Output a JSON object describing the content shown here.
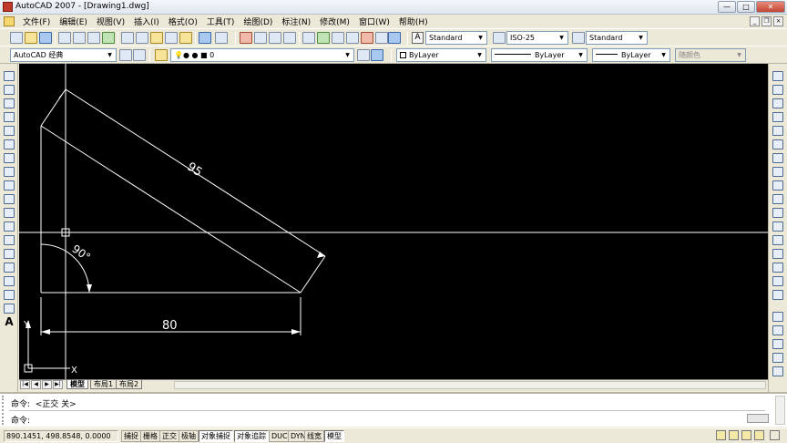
{
  "window": {
    "title": "AutoCAD 2007 - [Drawing1.dwg]"
  },
  "window_buttons": {
    "minimize": "—",
    "maximize": "□",
    "close": "✕"
  },
  "mdi_buttons": {
    "minimize": "_",
    "restore": "❐",
    "close": "×"
  },
  "menu": [
    "文件(F)",
    "编辑(E)",
    "视图(V)",
    "插入(I)",
    "格式(O)",
    "工具(T)",
    "绘图(D)",
    "标注(N)",
    "修改(M)",
    "窗口(W)",
    "帮助(H)"
  ],
  "styles_toolbar": {
    "text_style_icon": "A",
    "text_style": "Standard",
    "dim_style": "ISO-25",
    "table_style": "Standard"
  },
  "workspace": {
    "value": "AutoCAD 经典"
  },
  "layer": {
    "value": "0"
  },
  "properties": {
    "color": "ByLayer",
    "linetype": "ByLayer",
    "lineweight": "ByLayer",
    "plotstyle": "随颜色"
  },
  "drawing": {
    "dim_aligned": "95",
    "dim_linear": "80",
    "angle": "90°",
    "ucs_x": "X",
    "ucs_y": "Y",
    "line_color": "#ffffff",
    "background": "#000000"
  },
  "tabs": {
    "nav": [
      "|◀",
      "◀",
      "▶",
      "▶|"
    ],
    "items": [
      "模型",
      "布局1",
      "布局2"
    ],
    "active": "模型"
  },
  "command": {
    "history": "命令:  <正交 关>",
    "prompt": "命令:"
  },
  "status": {
    "coords": "890.1451,  498.8548, 0.0000",
    "buttons": [
      {
        "label": "捕捉",
        "on": false
      },
      {
        "label": "栅格",
        "on": false
      },
      {
        "label": "正交",
        "on": false
      },
      {
        "label": "极轴",
        "on": false
      },
      {
        "label": "对象捕捉",
        "on": true
      },
      {
        "label": "对象追踪",
        "on": true
      },
      {
        "label": "DUCS",
        "on": false
      },
      {
        "label": "DYN",
        "on": false
      },
      {
        "label": "线宽",
        "on": false
      },
      {
        "label": "模型",
        "on": true
      }
    ]
  },
  "icons": {
    "left_toolbar": [
      "line-icon",
      "construction-line-icon",
      "polyline-icon",
      "polygon-icon",
      "rectangle-icon",
      "arc-icon",
      "circle-icon",
      "revision-cloud-icon",
      "spline-icon",
      "ellipse-icon",
      "ellipse-arc-icon",
      "insert-block-icon",
      "make-block-icon",
      "point-icon",
      "hatch-icon",
      "gradient-icon",
      "region-icon",
      "table-icon",
      "multiline-text-icon"
    ],
    "right_toolbar": [
      "erase-icon",
      "copy-icon",
      "mirror-icon",
      "offset-icon",
      "array-icon",
      "move-icon",
      "rotate-icon",
      "scale-icon",
      "stretch-icon",
      "trim-icon",
      "extend-icon",
      "break-at-point-icon",
      "break-icon",
      "join-icon",
      "chamfer-icon",
      "fillet-icon",
      "explode-icon"
    ]
  }
}
